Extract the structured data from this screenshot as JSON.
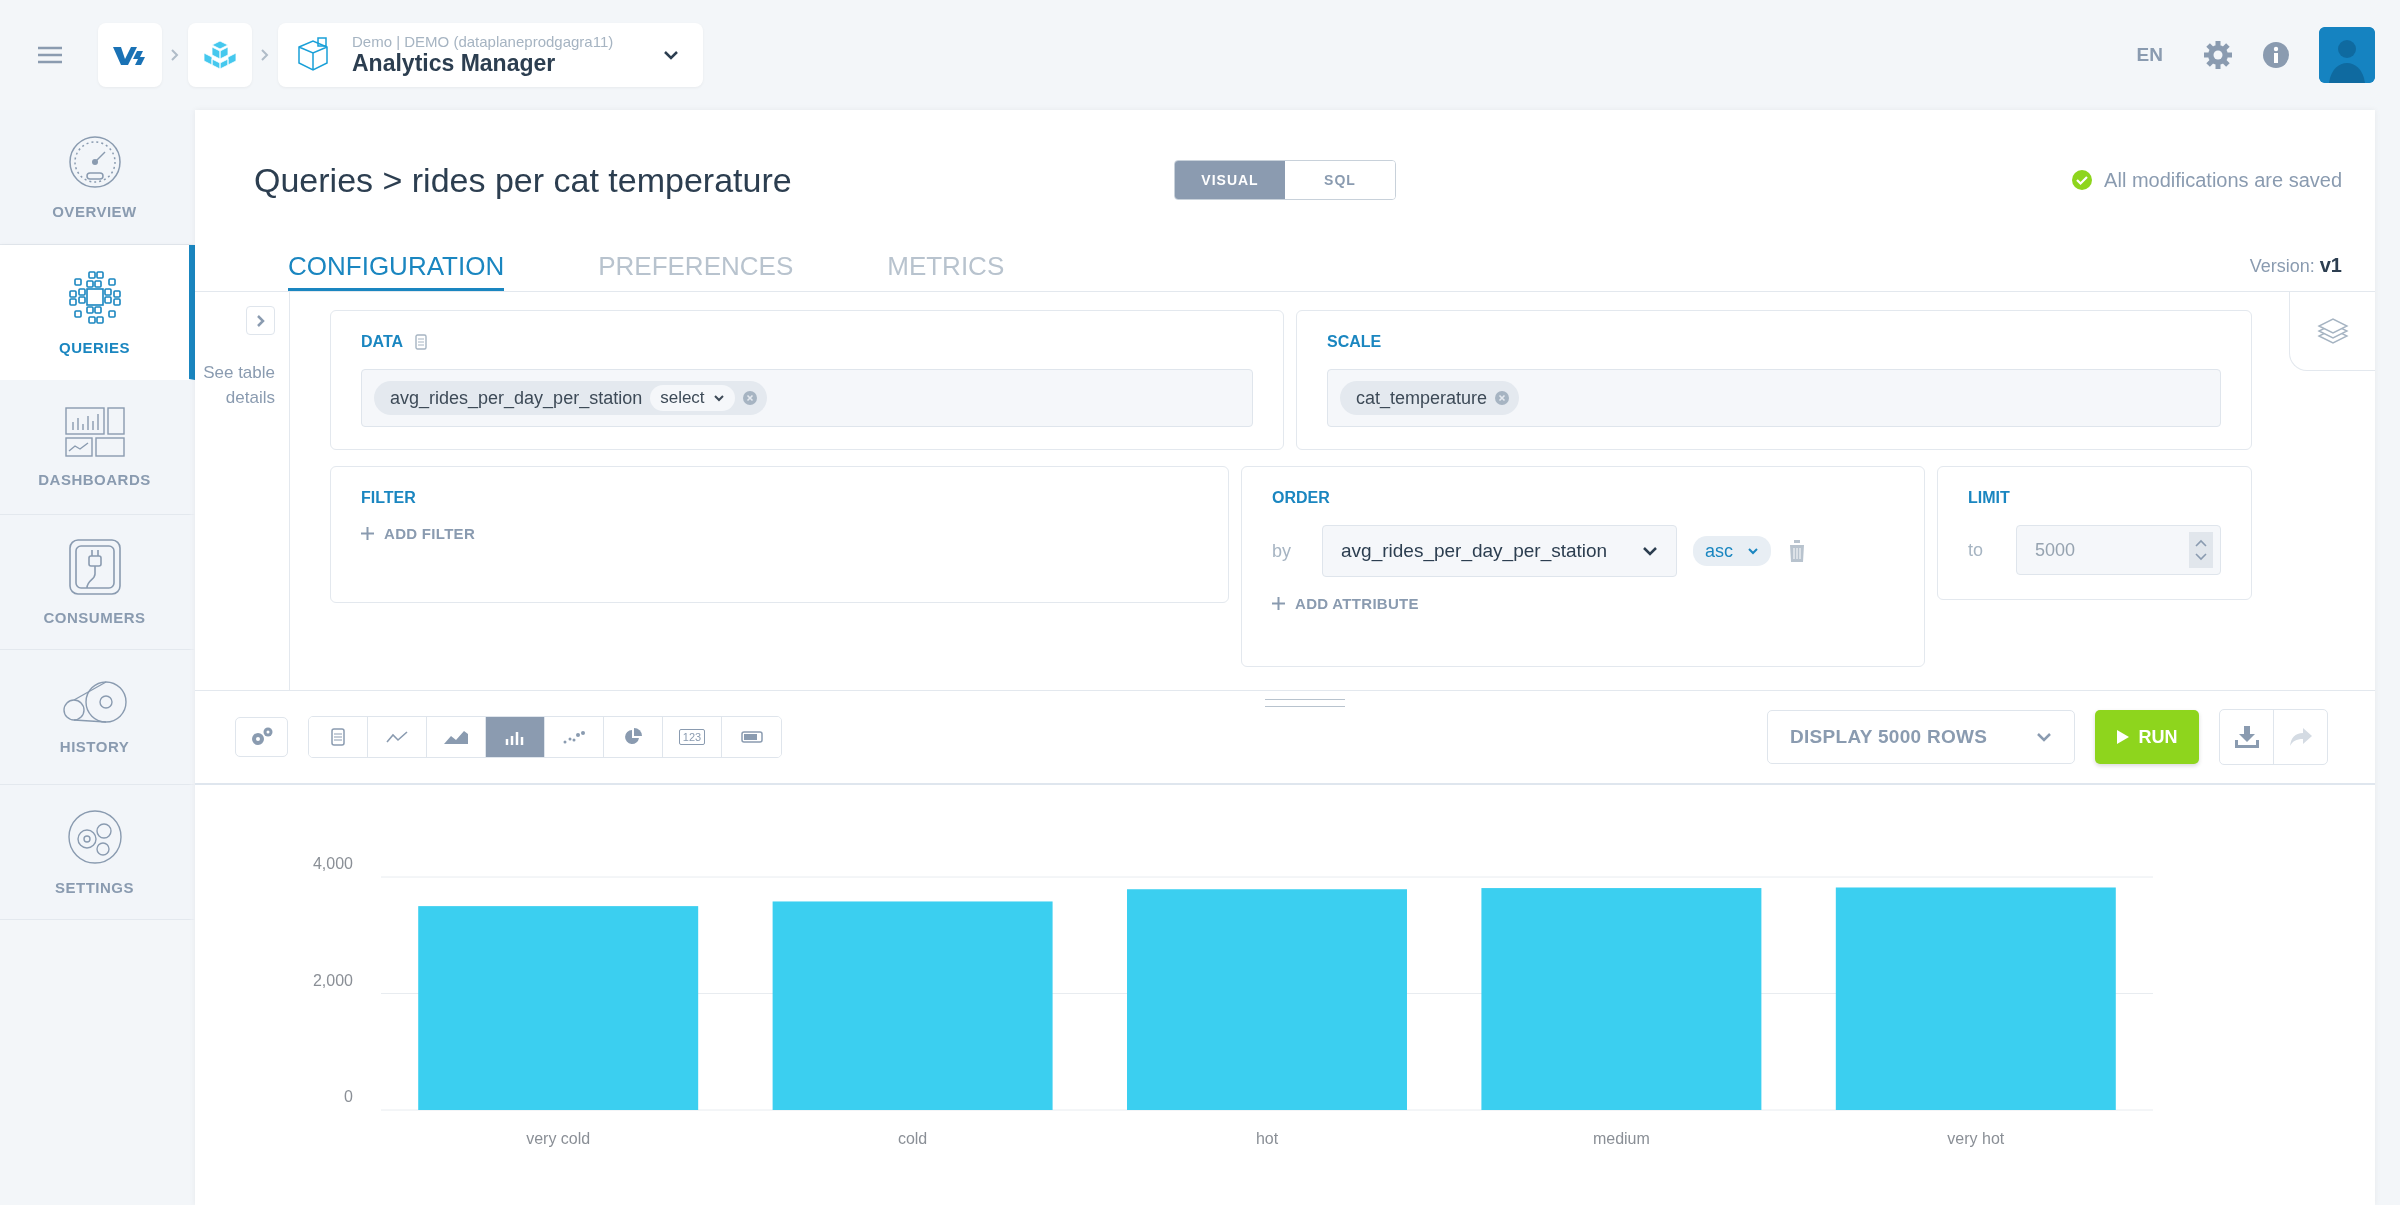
{
  "topbar": {
    "breadcrumb": {
      "subtitle": "Demo | DEMO (dataplaneprodgagra11)",
      "title": "Analytics Manager"
    },
    "language": "EN"
  },
  "sidebar": {
    "items": [
      {
        "label": "OVERVIEW",
        "selected": false
      },
      {
        "label": "QUERIES",
        "selected": true
      },
      {
        "label": "DASHBOARDS",
        "selected": false
      },
      {
        "label": "CONSUMERS",
        "selected": false
      },
      {
        "label": "HISTORY",
        "selected": false
      },
      {
        "label": "SETTINGS",
        "selected": false
      }
    ]
  },
  "header": {
    "title": "Queries > rides per cat temperature",
    "save_status": "All modifications are saved",
    "version_label": "Version:",
    "version": "v1"
  },
  "mode_toggle": [
    {
      "label": "VISUAL",
      "selected": true
    },
    {
      "label": "SQL",
      "selected": false
    }
  ],
  "tabs": [
    {
      "label": "CONFIGURATION",
      "selected": true
    },
    {
      "label": "PREFERENCES",
      "selected": false
    },
    {
      "label": "METRICS",
      "selected": false
    }
  ],
  "table_details": "See table details",
  "data_card": {
    "title": "DATA",
    "chips": [
      {
        "label": "avg_rides_per_day_per_station",
        "aggregation": "select"
      }
    ]
  },
  "scale_card": {
    "title": "SCALE",
    "chips": [
      {
        "label": "cat_temperature"
      }
    ]
  },
  "filter_card": {
    "title": "FILTER",
    "add_label": "ADD FILTER"
  },
  "order_card": {
    "title": "ORDER",
    "by_label": "by",
    "field": "avg_rides_per_day_per_station",
    "direction": "asc",
    "add_label": "ADD ATTRIBUTE"
  },
  "limit_card": {
    "title": "LIMIT",
    "to_label": "to",
    "placeholder": "5000"
  },
  "chart_types": [
    {
      "selected": false
    },
    {
      "selected": false
    },
    {
      "selected": false
    },
    {
      "selected": true
    },
    {
      "selected": false
    },
    {
      "selected": false
    },
    {
      "selected": false,
      "label": "123"
    },
    {
      "selected": false
    }
  ],
  "display_select": "DISPLAY 5000 ROWS",
  "run_button": "RUN",
  "chart": {
    "chart_data": {
      "type": "bar",
      "categories": [
        "very cold",
        "cold",
        "hot",
        "medium",
        "very hot"
      ],
      "series": [
        {
          "color": "#3bcff0",
          "values": [
            3500,
            3580,
            3790,
            3810,
            3820
          ]
        }
      ],
      "ylim": [
        0,
        4000
      ],
      "yticks": [
        {
          "value": 0,
          "label": "0"
        },
        {
          "value": 2000,
          "label": "2,000"
        },
        {
          "value": 4000,
          "label": "4,000"
        }
      ]
    }
  }
}
